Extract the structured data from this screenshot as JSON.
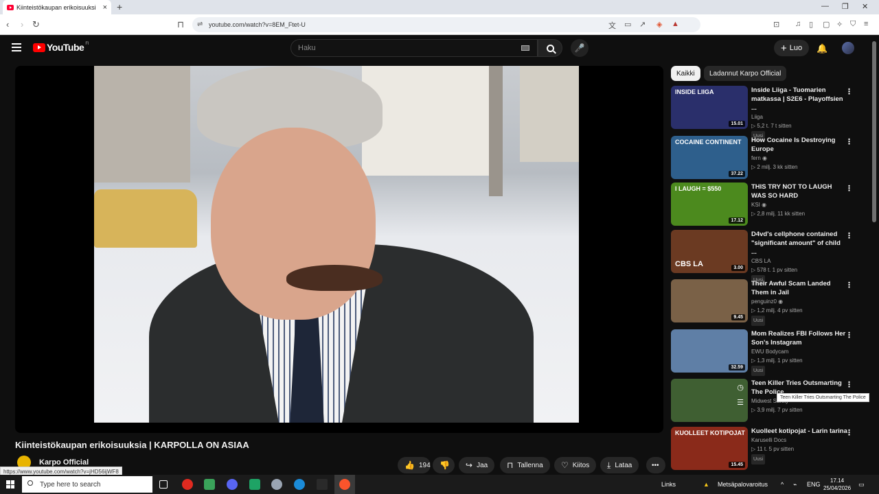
{
  "browser": {
    "tab_title": "Kiinteistökaupan erikoisuuksi",
    "tab_close": "×",
    "new_tab": "+",
    "url": "youtube.com/watch?v=8EM_Ftet-U",
    "window_controls": [
      "—",
      "❐",
      "✕"
    ],
    "status_url": "https://www.youtube.com/watch?v=jHD56ijWF8"
  },
  "header": {
    "logo_text": "YouTube",
    "region": "FI",
    "search_placeholder": "Haku",
    "create_label": "Luo",
    "create_plus": "+"
  },
  "video": {
    "title": "Kiinteistökaupan erikoisuuksia | KARPOLLA ON ASIAA",
    "channel_name": "Karpo Official",
    "likes": "194",
    "share": "Jaa",
    "save": "Tallenna",
    "thanks": "Kiitos",
    "download": "Lataa"
  },
  "chips": [
    "Kaikki",
    "Ladannut Karpo Official"
  ],
  "recommendations": [
    {
      "title": "Inside Liiga - Tuomarien matkassa | S2E6 - Playoffsien ...",
      "channel": "Liiga",
      "views_age": "▷ 5,2 t.   7 t sitten",
      "badge": "Uusi",
      "duration": "15.01",
      "thumb_text": "INSIDE LIIGA",
      "color": "#2a2f6b"
    },
    {
      "title": "How Cocaine Is Destroying Europe",
      "channel": "fern ◉",
      "views_age": "▷ 2 milj.   3 kk sitten",
      "badge": "",
      "duration": "37.22",
      "thumb_text": "COCAINE CONTINENT",
      "color": "#2e5f8c"
    },
    {
      "title": "THIS TRY NOT TO LAUGH WAS SO HARD",
      "channel": "KSI ◉",
      "views_age": "▷ 2,8 milj.   11 kk sitten",
      "badge": "",
      "duration": "17.12",
      "thumb_text": "I LAUGH = $550",
      "color": "#4c8a1e"
    },
    {
      "title": "D4vd's cellphone contained \"significant amount\" of child ...",
      "channel": "CBS LA",
      "views_age": "▷ 578 t.   1 pv sitten",
      "badge": "Uusi",
      "duration": "3.00",
      "thumb_text": "CBS LA",
      "color": "#6b3a22"
    },
    {
      "title": "Their Awful Scam Landed Them in Jail",
      "channel": "penguinz0 ◉",
      "views_age": "▷ 1,2 milj.   4 pv sitten",
      "badge": "Uusi",
      "duration": "9.45",
      "thumb_text": "",
      "color": "#7a6147"
    },
    {
      "title": "Mom Realizes FBI Follows Her Son's Instagram",
      "channel": "EWU Bodycam",
      "views_age": "▷ 1,3 milj.   1 pv sitten",
      "badge": "Uusi",
      "duration": "32.59",
      "thumb_text": "",
      "color": "#5f7fa6"
    },
    {
      "title": "Teen Killer Tries Outsmarting The Police",
      "channel": "Midwest Safety",
      "views_age": "▷ 3,9 milj.   7 pv sitten",
      "badge": "",
      "duration": "",
      "thumb_text": "",
      "color": "#3f5f32"
    },
    {
      "title": "Kuolleet kotipojat - Larin tarina",
      "channel": "Karuselli Docs",
      "views_age": "▷ 11 t.   5 pv sitten",
      "badge": "Uusi",
      "duration": "15.45",
      "thumb_text": "KUOLLEET KOTIPOJAT",
      "color": "#8a2a1a"
    }
  ],
  "tooltip": "Teen Killer Tries Outsmarting The Police",
  "taskbar": {
    "search_placeholder": "Type here to search",
    "links": "Links",
    "weather": "Metsäpalovaroitus",
    "lang": "ENG",
    "time": "17.14",
    "date": "25/04/2026"
  }
}
